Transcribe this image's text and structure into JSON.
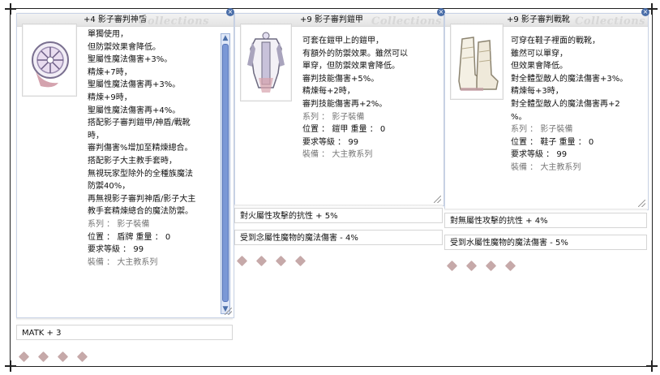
{
  "panels": [
    {
      "title": "+4 影子審判神盾",
      "watermark": "Collections",
      "close_glyph": "×",
      "icon": "shield-icon",
      "lines": [
        "單獨使用，",
        "但防禦效果會降低。",
        "聖屬性魔法傷害+3%。",
        "精煉+7時，",
        "聖屬性魔法傷害再+3%。",
        "精煉+9時，",
        "聖屬性魔法傷害再+4%。",
        "搭配影子審判鎧甲/神盾/戰靴",
        "時，",
        "審判傷害%增加至精煉總合。",
        "搭配影子大主教手套時，",
        "無視玩家型除外的全種族魔法",
        "防禦40%，",
        "再無視影子審判神盾/影子大主",
        "教手套精煉總合的魔法防禦。"
      ],
      "props": [
        "系列 ： 影子裝備",
        "位置 ： 盾牌 重量 ： 0",
        "要求等級 ： 99",
        "裝備 ： 大主教系列"
      ],
      "bars": [
        "MATK + 3"
      ]
    },
    {
      "title": "+9 影子審判鎧甲",
      "watermark": "Collections",
      "close_glyph": "×",
      "icon": "armor-icon",
      "lines": [
        "可套在鎧甲上的鎧甲，",
        "有額外的防禦效果。雖然可以",
        "單穿，但防禦效果會降低。",
        "審判技能傷害+5%。",
        "精煉每+2時，",
        "審判技能傷害再+2%。"
      ],
      "props": [
        "系列 ： 影子裝備",
        "位置 ： 鎧甲 重量 ： 0",
        "要求等級 ： 99",
        "裝備 ： 大主教系列"
      ],
      "bars": [
        "對火屬性攻擊的抗性 + 5%",
        "受到念屬性魔物的魔法傷害 - 4%"
      ]
    },
    {
      "title": "+9 影子審判戰靴",
      "watermark": "Collections",
      "close_glyph": "×",
      "icon": "boots-icon",
      "lines": [
        "可穿在鞋子裡面的戰靴，",
        "雖然可以單穿，",
        "但效果會降低。",
        "對全體型敵人的魔法傷害+3%。",
        "精煉每+3時，",
        "對全體型敵人的魔法傷害再+2",
        "%。"
      ],
      "props": [
        "系列 ： 影子裝備",
        "位置 ： 鞋子 重量 ： 0",
        "要求等級 ： 99",
        "裝備 ： 大主教系列"
      ],
      "bars": [
        "對無屬性攻擊的抗性 + 4%",
        "受到水屬性魔物的魔法傷害 - 5%"
      ]
    }
  ]
}
